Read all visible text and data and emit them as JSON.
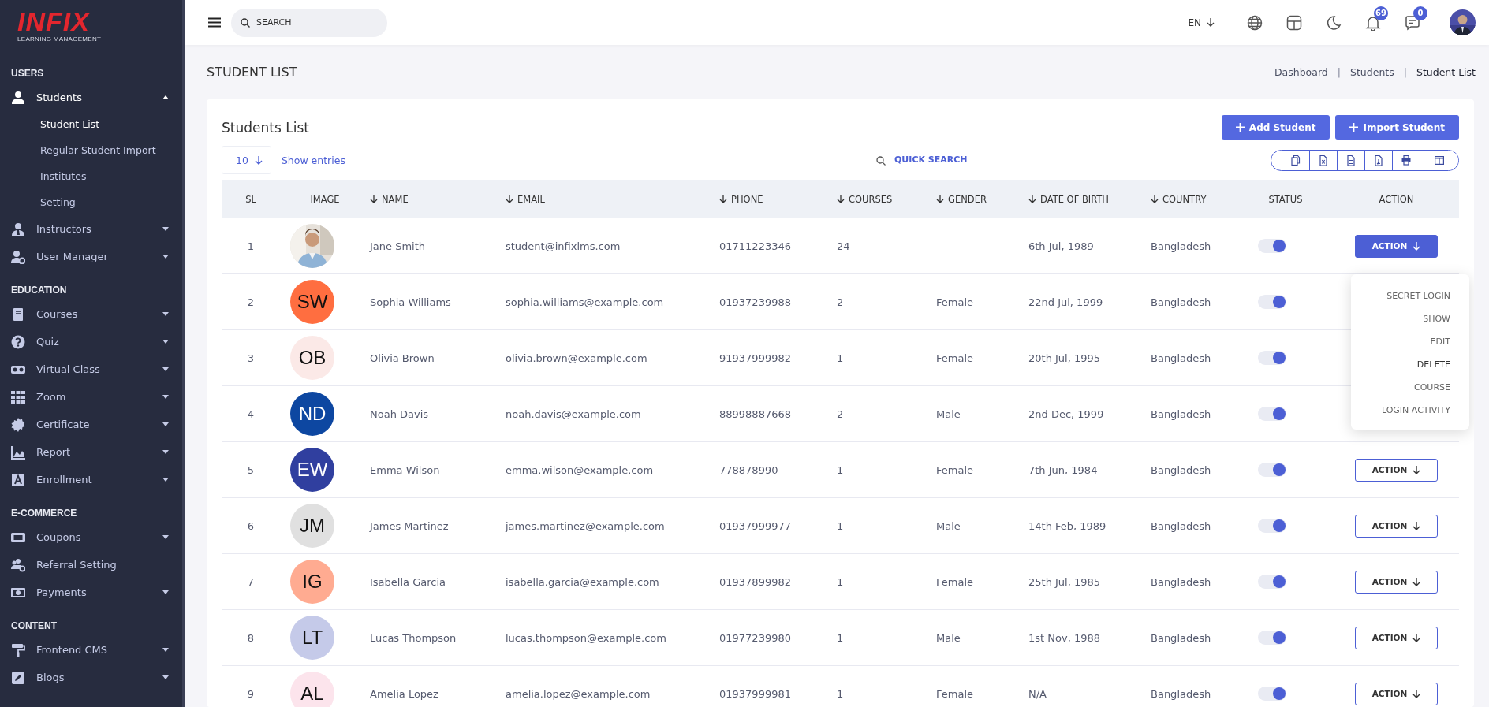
{
  "sidebar": {
    "logo": {
      "title": "INFIX",
      "subtitle": "LEARNING MANAGEMENT"
    },
    "sections": [
      {
        "title": "USERS",
        "items": [
          {
            "label": "Students",
            "selected": true,
            "expanded": true,
            "children": [
              {
                "label": "Student List",
                "selected": true
              },
              {
                "label": "Regular Student Import",
                "selected": false
              },
              {
                "label": "Institutes",
                "selected": false
              },
              {
                "label": "Setting",
                "selected": false
              }
            ]
          },
          {
            "label": "Instructors",
            "selected": false,
            "expanded": false
          },
          {
            "label": "User Manager",
            "selected": false,
            "expanded": false
          }
        ]
      },
      {
        "title": "EDUCATION",
        "items": [
          {
            "label": "Courses",
            "selected": false,
            "expanded": false
          },
          {
            "label": "Quiz",
            "selected": false,
            "expanded": false
          },
          {
            "label": "Virtual Class",
            "selected": false,
            "expanded": false
          },
          {
            "label": "Zoom",
            "selected": false,
            "expanded": false
          },
          {
            "label": "Certificate",
            "selected": false,
            "expanded": false
          },
          {
            "label": "Report",
            "selected": false,
            "expanded": false
          },
          {
            "label": "Enrollment",
            "selected": false,
            "expanded": false
          }
        ]
      },
      {
        "title": "E-COMMERCE",
        "items": [
          {
            "label": "Coupons",
            "selected": false,
            "expanded": false
          },
          {
            "label": "Referral Setting",
            "selected": false
          },
          {
            "label": "Payments",
            "selected": false,
            "expanded": false
          }
        ]
      },
      {
        "title": "CONTENT",
        "items": [
          {
            "label": "Frontend CMS",
            "selected": false,
            "expanded": false
          },
          {
            "label": "Blogs",
            "selected": false,
            "expanded": false
          }
        ]
      }
    ]
  },
  "topbar": {
    "search": {
      "placeholder": "SEARCH"
    },
    "language": "EN",
    "notifications": "69",
    "messages": "0"
  },
  "page": {
    "title": "STUDENT LIST",
    "breadcrumbs": [
      {
        "kind": "link",
        "label": "Dashboard"
      },
      {
        "kind": "separator",
        "label": "|"
      },
      {
        "kind": "link",
        "label": "Students"
      },
      {
        "kind": "separator",
        "label": "|"
      },
      {
        "kind": "current",
        "label": "Student List"
      }
    ]
  },
  "card": {
    "title": "Students List",
    "buttons": [
      "Add Student",
      "Import Student"
    ],
    "entries": "10",
    "entries_label": "Show entries",
    "quick_search": {
      "placeholder": "QUICK SEARCH"
    }
  },
  "table": {
    "columns": [
      {
        "label": "SL",
        "sortable": false
      },
      {
        "label": "IMAGE",
        "sortable": false
      },
      {
        "label": "NAME",
        "sortable": true
      },
      {
        "label": "EMAIL",
        "sortable": true
      },
      {
        "label": "PHONE",
        "sortable": true
      },
      {
        "label": "COURSES",
        "sortable": true
      },
      {
        "label": "GENDER",
        "sortable": true
      },
      {
        "label": "DATE OF BIRTH",
        "sortable": true
      },
      {
        "label": "COUNTRY",
        "sortable": true
      },
      {
        "label": "STATUS",
        "sortable": false
      },
      {
        "label": "ACTION",
        "sortable": false
      }
    ],
    "rows": [
      {
        "sl": "1",
        "name": "Jane Smith",
        "email": "student@infixlms.com",
        "phone": "01711223346",
        "courses": "24",
        "dob": "6th Jul, 1989",
        "country": "Bangladesh",
        "status_on": true,
        "action": {
          "label": "ACTION",
          "open": true
        }
      },
      {
        "sl": "2",
        "image": {
          "kind": "initials",
          "text": "SW",
          "color": "#ff6e40"
        },
        "name": "Sophia Williams",
        "email": "sophia.williams@example.com",
        "phone": "01937239988",
        "courses": "2",
        "gender": "Female",
        "dob": "22nd Jul, 1999",
        "country": "Bangladesh",
        "status_on": true
      },
      {
        "sl": "3",
        "image": {
          "kind": "initials",
          "text": "OB",
          "color": "#fbe9e7"
        },
        "name": "Olivia Brown",
        "email": "olivia.brown@example.com",
        "phone": "91937999982",
        "courses": "1",
        "gender": "Female",
        "dob": "20th Jul, 1995",
        "country": "Bangladesh",
        "status_on": true
      },
      {
        "sl": "4",
        "image": {
          "kind": "initials",
          "text": "ND",
          "color": "#0d47a1"
        },
        "name": "Noah Davis",
        "email": "noah.davis@example.com",
        "phone": "88998887668",
        "courses": "2",
        "gender": "Male",
        "dob": "2nd Dec, 1999",
        "country": "Bangladesh",
        "status_on": true
      },
      {
        "sl": "5",
        "image": {
          "kind": "initials",
          "text": "EW",
          "color": "#303f9f"
        },
        "name": "Emma Wilson",
        "email": "emma.wilson@example.com",
        "phone": "778878990",
        "courses": "1",
        "gender": "Female",
        "dob": "7th Jun, 1984",
        "country": "Bangladesh",
        "status_on": true,
        "action": {
          "label": "ACTION",
          "open": false
        }
      },
      {
        "sl": "6",
        "image": {
          "kind": "initials",
          "text": "JM",
          "color": "#e0e0e0"
        },
        "name": "James Martinez",
        "email": "james.martinez@example.com",
        "phone": "01937999977",
        "courses": "1",
        "gender": "Male",
        "dob": "14th Feb, 1989",
        "country": "Bangladesh",
        "status_on": true,
        "action": {
          "label": "ACTION",
          "open": false
        }
      },
      {
        "sl": "7",
        "image": {
          "kind": "initials",
          "text": "IG",
          "color": "#ffab91"
        },
        "name": "Isabella Garcia",
        "email": "isabella.garcia@example.com",
        "phone": "01937899982",
        "courses": "1",
        "gender": "Female",
        "dob": "25th Jul, 1985",
        "country": "Bangladesh",
        "status_on": true,
        "action": {
          "label": "ACTION",
          "open": false
        }
      },
      {
        "sl": "8",
        "image": {
          "kind": "initials",
          "text": "LT",
          "color": "#c5cae9"
        },
        "name": "Lucas Thompson",
        "email": "lucas.thompson@example.com",
        "phone": "01977239980",
        "courses": "1",
        "gender": "Male",
        "dob": "1st Nov, 1988",
        "country": "Bangladesh",
        "status_on": true,
        "action": {
          "label": "ACTION",
          "open": false
        }
      },
      {
        "sl": "9",
        "image": {
          "kind": "initials",
          "text": "AL",
          "color": "#fce4ec"
        },
        "name": "Amelia Lopez",
        "email": "amelia.lopez@example.com",
        "phone": "01937999981",
        "courses": "1",
        "gender": "Female",
        "dob": "N/A",
        "country": "Bangladesh",
        "status_on": true,
        "action": {
          "label": "ACTION",
          "open": false
        }
      }
    ]
  },
  "action_menu": {
    "items": [
      {
        "label": "SECRET LOGIN",
        "hovered": false
      },
      {
        "label": "SHOW",
        "hovered": false
      },
      {
        "label": "EDIT",
        "hovered": false
      },
      {
        "label": "DELETE",
        "hovered": true
      },
      {
        "label": "COURSE",
        "hovered": false
      },
      {
        "label": "LOGIN ACTIVITY",
        "hovered": false
      }
    ]
  }
}
